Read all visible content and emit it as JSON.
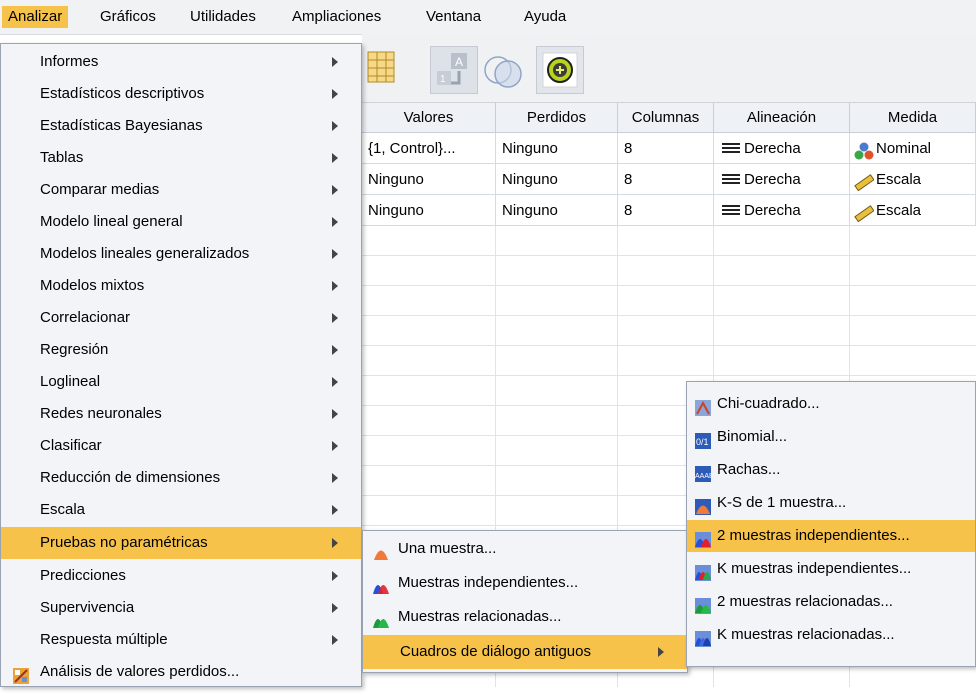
{
  "menubar": {
    "items": [
      "Analizar",
      "Gráficos",
      "Utilidades",
      "Ampliaciones",
      "Ventana",
      "Ayuda"
    ]
  },
  "toolbar": {
    "icons": [
      "grid-icon",
      "swap-variables-icon",
      "venn-icon",
      "add-circle-icon"
    ]
  },
  "grid": {
    "columns": [
      "Valores",
      "Perdidos",
      "Columnas",
      "Alineación",
      "Medida"
    ],
    "rows": [
      {
        "valores": "{1, Control}...",
        "perdidos": "Ninguno",
        "columnas": "8",
        "alineacion": "Derecha",
        "medida": "Nominal"
      },
      {
        "valores": "Ninguno",
        "perdidos": "Ninguno",
        "columnas": "8",
        "alineacion": "Derecha",
        "medida": "Escala"
      },
      {
        "valores": "Ninguno",
        "perdidos": "Ninguno",
        "columnas": "8",
        "alineacion": "Derecha",
        "medida": "Escala"
      }
    ]
  },
  "analizar_menu": {
    "items": [
      "Informes",
      "Estadísticos descriptivos",
      "Estadísticas Bayesianas",
      "Tablas",
      "Comparar medias",
      "Modelo lineal general",
      "Modelos lineales generalizados",
      "Modelos mixtos",
      "Correlacionar",
      "Regresión",
      "Loglineal",
      "Redes neuronales",
      "Clasificar",
      "Reducción de dimensiones",
      "Escala",
      "Pruebas no paramétricas",
      "Predicciones",
      "Supervivencia",
      "Respuesta múltiple",
      "Análisis de valores perdidos..."
    ]
  },
  "noparam_menu": {
    "items": [
      "Una muestra...",
      "Muestras independientes...",
      "Muestras relacionadas...",
      "Cuadros de diálogo antiguos"
    ]
  },
  "antiguos_menu": {
    "items": [
      "Chi-cuadrado...",
      "Binomial...",
      "Rachas...",
      "K-S de 1 muestra...",
      "2 muestras independientes...",
      "K muestras independientes...",
      "2 muestras relacionadas...",
      "K muestras relacionadas..."
    ]
  },
  "colors": {
    "highlight": "#f7c24a",
    "menu_bg": "#f3f4f7",
    "header_bg": "#eef1f6"
  }
}
